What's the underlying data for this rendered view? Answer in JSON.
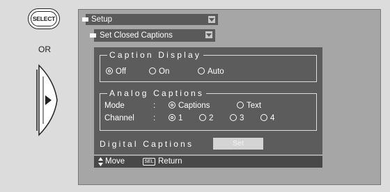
{
  "remote": {
    "select_label": "SELECT",
    "or_label": "OR",
    "dpad_icon": "dpad-right-icon"
  },
  "menu": {
    "title": "Setup",
    "submenu": "Set Closed Captions"
  },
  "caption_display": {
    "title": "Caption Display",
    "options": [
      {
        "label": "Off",
        "selected": true
      },
      {
        "label": "On",
        "selected": false
      },
      {
        "label": "Auto",
        "selected": false
      }
    ]
  },
  "analog_captions": {
    "title": "Analog Captions",
    "mode_label": "Mode",
    "mode_options": [
      {
        "label": "Captions",
        "selected": true
      },
      {
        "label": "Text",
        "selected": false
      }
    ],
    "channel_label": "Channel",
    "channel_options": [
      {
        "label": "1",
        "selected": true
      },
      {
        "label": "2",
        "selected": false
      },
      {
        "label": "3",
        "selected": false
      },
      {
        "label": "4",
        "selected": false
      }
    ],
    "separator": ":"
  },
  "digital_captions": {
    "title": "Digital Captions",
    "button_label": "Set"
  },
  "status": {
    "move_label": "Move",
    "sel_icon": "SEL",
    "return_label": "Return"
  },
  "colors": {
    "panel": "#5c5c5c",
    "menu_bar": "#5a5a5a",
    "screen_bg": "#a6a6a6",
    "page_bg": "#dcdcdc"
  }
}
